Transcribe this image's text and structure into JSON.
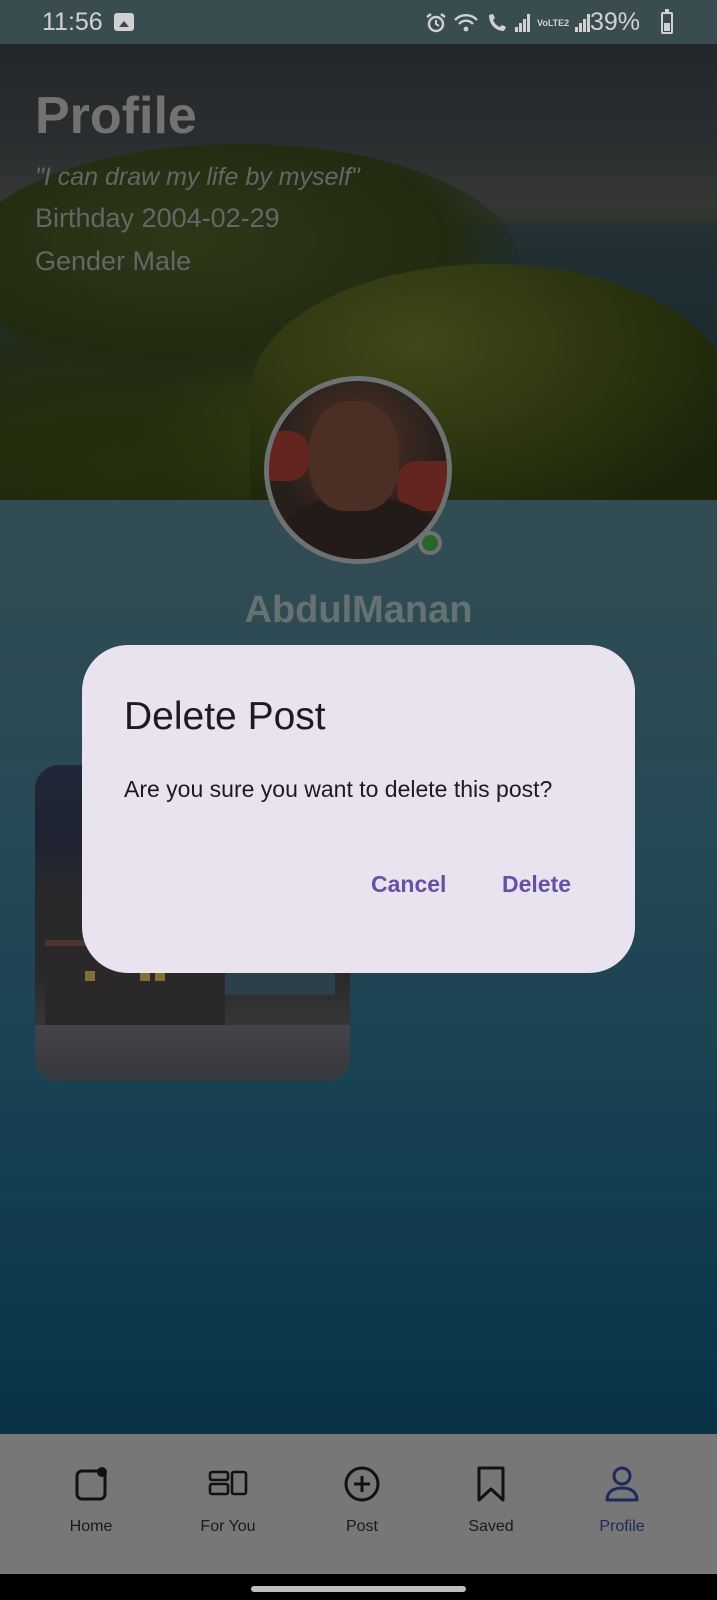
{
  "status_bar": {
    "time": "11:56",
    "battery_percent": "39%",
    "network_label": "VoLTE2",
    "icons": [
      "gallery-icon",
      "alarm-icon",
      "wifi-icon",
      "wifi-call-icon",
      "signal-icon",
      "signal-icon"
    ]
  },
  "profile": {
    "title": "Profile",
    "quote": "\"I can draw my life by myself\"",
    "birthday": "Birthday 2004-02-29",
    "gender": "Gender Male",
    "username": "AbdulManan",
    "online": true
  },
  "dialog": {
    "title": "Delete Post",
    "message": "Are you sure you want to delete this post?",
    "cancel_label": "Cancel",
    "delete_label": "Delete",
    "accent_color": "#6750a4"
  },
  "bottom_nav": {
    "items": [
      {
        "label": "Home",
        "icon": "home-icon"
      },
      {
        "label": "For You",
        "icon": "for-you-icon"
      },
      {
        "label": "Post",
        "icon": "add-post-icon"
      },
      {
        "label": "Saved",
        "icon": "bookmark-icon"
      },
      {
        "label": "Profile",
        "icon": "person-icon",
        "active": true
      }
    ]
  }
}
